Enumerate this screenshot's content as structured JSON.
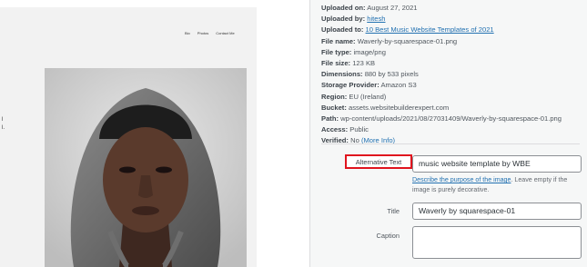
{
  "preview": {
    "nav": [
      "Bio",
      "Photos",
      "Contact Me"
    ],
    "side_marks": [
      "l",
      "l."
    ]
  },
  "details": {
    "uploaded_on": {
      "label": "Uploaded on:",
      "value": "August 27, 2021"
    },
    "uploaded_by": {
      "label": "Uploaded by:",
      "value": "hitesh"
    },
    "uploaded_to": {
      "label": "Uploaded to:",
      "value": "10 Best Music Website Templates of 2021"
    },
    "file_name": {
      "label": "File name:",
      "value": "Waverly-by-squarespace-01.png"
    },
    "file_type": {
      "label": "File type:",
      "value": "image/png"
    },
    "file_size": {
      "label": "File size:",
      "value": "123 KB"
    },
    "dimensions": {
      "label": "Dimensions:",
      "value": "880 by 533 pixels"
    },
    "storage": {
      "label": "Storage Provider:",
      "value": "Amazon S3"
    },
    "region": {
      "label": "Region:",
      "value": "EU (Ireland)"
    },
    "bucket": {
      "label": "Bucket:",
      "value": "assets.websitebuilderexpert.com"
    },
    "path": {
      "label": "Path:",
      "value": "wp-content/uploads/2021/08/27031409/Waverly-by-squarespace-01.png"
    },
    "access": {
      "label": "Access:",
      "value": "Public"
    },
    "verified": {
      "label": "Verified:",
      "value": "No",
      "link": "(More Info)"
    }
  },
  "fields": {
    "alt_text": {
      "label": "Alternative Text",
      "value": "music website template by WBE",
      "help_link": "Describe the purpose of the image",
      "help_text": ". Leave empty if the image is purely decorative."
    },
    "title": {
      "label": "Title",
      "value": "Waverly by squarespace-01"
    },
    "caption": {
      "label": "Caption",
      "value": ""
    }
  },
  "colors": {
    "link": "#2271b1",
    "highlight_box": "#e0141e",
    "panel_bg": "#f6f7f7"
  }
}
